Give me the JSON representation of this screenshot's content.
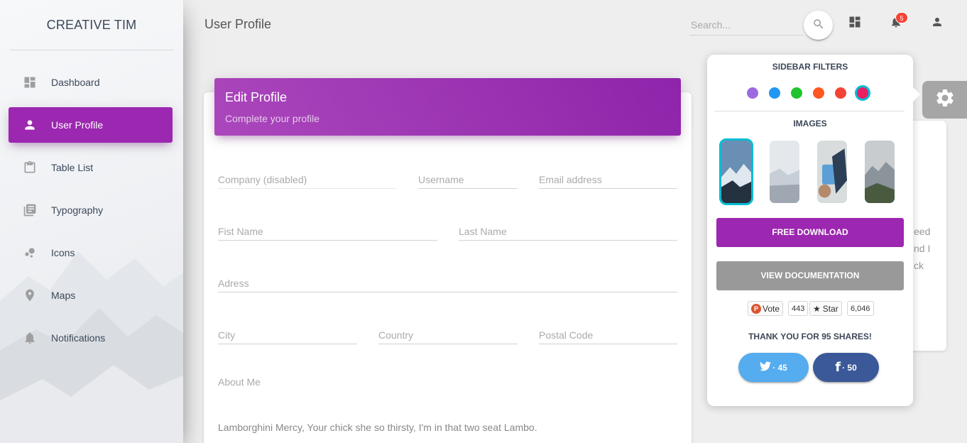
{
  "sidebar": {
    "brand": "CREATIVE TIM",
    "items": [
      {
        "label": "Dashboard",
        "icon": "dashboard-icon"
      },
      {
        "label": "User Profile",
        "icon": "person-icon",
        "active": true
      },
      {
        "label": "Table List",
        "icon": "clipboard-icon"
      },
      {
        "label": "Typography",
        "icon": "library-books-icon"
      },
      {
        "label": "Icons",
        "icon": "bubble-chart-icon"
      },
      {
        "label": "Maps",
        "icon": "location-pin-icon"
      },
      {
        "label": "Notifications",
        "icon": "bell-icon"
      }
    ],
    "active_color": "#9c27b0"
  },
  "topbar": {
    "title": "User Profile",
    "search_placeholder": "Search...",
    "notification_count": "5",
    "icons": [
      "search-icon",
      "dashboard-icon",
      "bell-icon",
      "person-icon"
    ]
  },
  "profile_card": {
    "title": "Edit Profile",
    "category": "Complete your profile",
    "fields": {
      "company": "Company (disabled)",
      "username": "Username",
      "email": "Email address",
      "first_name": "Fist Name",
      "last_name": "Last Name",
      "address": "Adress",
      "city": "City",
      "country": "Country",
      "postal_code": "Postal Code"
    },
    "about_label": "About Me",
    "about_text": "Lamborghini Mercy, Your chick she so thirsty, I'm in that two seat Lambo."
  },
  "background_card": {
    "lines": [
      "eed",
      "nd I",
      "ck"
    ]
  },
  "plugin": {
    "sidebar_filters_title": "SIDEBAR FILTERS",
    "colors": [
      "#9c6ae0",
      "#2196f3",
      "#22c32e",
      "#ff5722",
      "#f44336",
      "#e91e63"
    ],
    "active_color_index": 5,
    "images_title": "IMAGES",
    "images": [
      "sidebar-image-1",
      "sidebar-image-2",
      "sidebar-image-3",
      "sidebar-image-4"
    ],
    "active_image_index": 0,
    "free_download": "FREE DOWNLOAD",
    "view_documentation": "VIEW DOCUMENTATION",
    "vote_label": "Vote",
    "vote_count": "443",
    "star_label": "Star",
    "star_count": "6,046",
    "thanks": "THANK YOU FOR 95 SHARES!",
    "twitter_count": "· 45",
    "facebook_count": "· 50"
  }
}
